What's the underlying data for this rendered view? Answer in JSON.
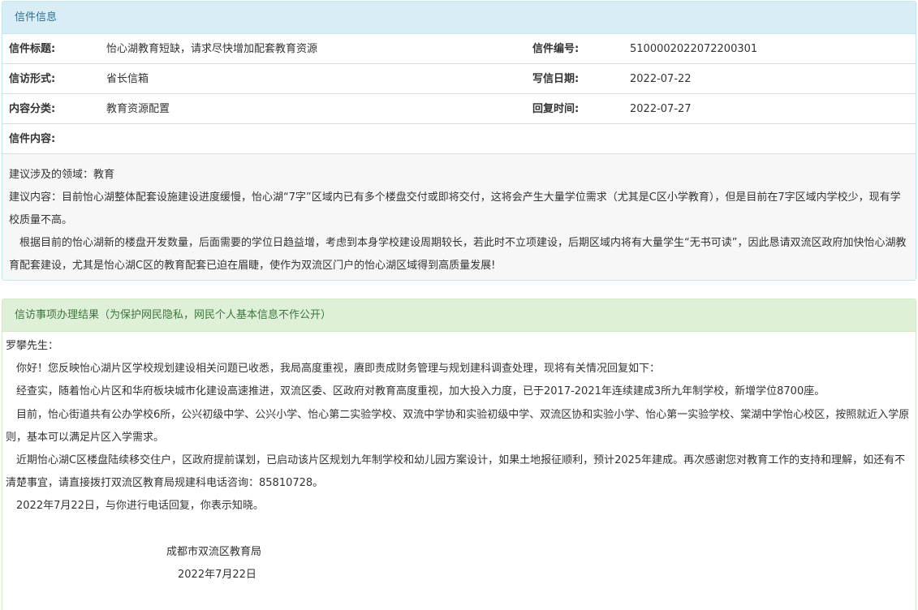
{
  "letter_info": {
    "header": "信件信息",
    "title_label": "信件标题:",
    "title_value": "怡心湖教育短缺，请求尽快增加配套教育资源",
    "number_label": "信件编号:",
    "number_value": "5100002022072200301",
    "form_label": "信访形式:",
    "form_value": "省长信箱",
    "date_label": "写信日期:",
    "date_value": "2022-07-22",
    "category_label": "内容分类:",
    "category_value": "教育资源配置",
    "reply_time_label": "回复时间:",
    "reply_time_value": "2022-07-27",
    "content_label": "信件内容:",
    "content_lines": [
      "建议涉及的领域：教育",
      "建议内容：目前怡心湖整体配套设施建设进度缓慢，怡心湖“7字”区域内已有多个楼盘交付或即将交付，这将会产生大量学位需求（尤其是C区小学教育），但是目前在7字区域内学校少，现有学校质量不高。",
      "　根据目前的怡心湖新的楼盘开发数量，后面需要的学位日趋益增，考虑到本身学校建设周期较长，若此时不立项建设，后期区域内将有大量学生“无书可读”，因此恳请双流区政府加快怡心湖教育配套建设，尤其是怡心湖C区的教育配套已迫在眉睫，使作为双流区门户的怡心湖区域得到高质量发展!"
    ]
  },
  "result": {
    "header": "信访事项办理结果（为保护网民隐私，网民个人基本信息不作公开）",
    "paragraphs": [
      "罗攀先生：",
      "　你好！您反映怡心湖片区学校规划建设相关问题已收悉，我局高度重视，赓即责成财务管理与规划建科调查处理，现将有关情况回复如下：",
      "　经查实，随着怡心片区和华府板块城市化建设高速推进，双流区委、区政府对教育高度重视，加大投入力度，已于2017-2021年连续建成3所九年制学校，新增学位8700座。",
      "　目前，怡心街道共有公办学校6所，公兴初级中学、公兴小学、怡心第二实验学校、双流中学协和实验初级中学、双流区协和实验小学、怡心第一实验学校、棠湖中学怡心校区，按照就近入学原则，基本可以满足片区入学需求。",
      "　近期怡心湖C区楼盘陆续移交住户，区政府提前谋划，已启动该片区规划九年制学校和幼儿园方案设计，如果土地报征顺利，预计2025年建成。再次感谢您对教育工作的支持和理解，如还有不清楚事宜，请直接拨打双流区教育局规建科电话咨询：85810728。",
      "　2022年7月22日，与你进行电话回复，你表示知晓。"
    ],
    "signature_org": "成都市双流区教育局",
    "signature_date": "2022年7月22日"
  }
}
